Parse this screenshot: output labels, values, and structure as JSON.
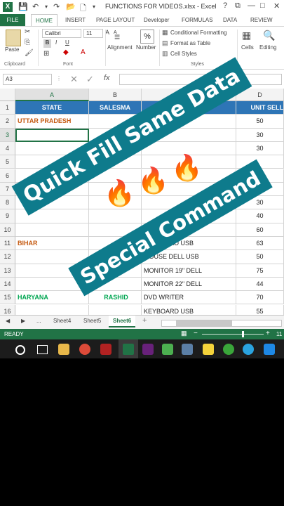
{
  "app": {
    "title": "FUNCTIONS FOR VIDEOS.xlsx - Excel",
    "window_controls": [
      "?",
      "⧉",
      "—",
      "□",
      "✕"
    ]
  },
  "tabs": [
    {
      "label": "FILE"
    },
    {
      "label": "HOME"
    },
    {
      "label": "INSERT"
    },
    {
      "label": "PAGE LAYOUT"
    },
    {
      "label": "Developer"
    },
    {
      "label": "FORMULAS"
    },
    {
      "label": "DATA"
    },
    {
      "label": "REVIEW"
    }
  ],
  "ribbon": {
    "paste_label": "Paste",
    "font_name": "Calibri",
    "font_size": "11",
    "bold": "B",
    "italic": "I",
    "underline": "U",
    "alignment_label": "Alignment",
    "number_label": "Number",
    "percent": "%",
    "conditional_formatting": "Conditional Formatting",
    "format_as_table": "Format as Table",
    "cell_styles": "Cell Styles",
    "cells_label": "Cells",
    "editing_label": "Editing",
    "group_clipboard": "Clipboard",
    "group_font": "Font",
    "group_styles": "Styles"
  },
  "formula_bar": {
    "name_box": "A3",
    "fx": "fx",
    "content": ""
  },
  "grid": {
    "columns": [
      "A",
      "B",
      "C",
      "D"
    ],
    "header_row": {
      "state": "STATE",
      "salesman": "SALESMA",
      "unit_sell": "UNIT SELL"
    },
    "rows": [
      {
        "num": "1"
      },
      {
        "num": "2",
        "a": "UTTAR PRADESH",
        "c": "",
        "d": "50"
      },
      {
        "num": "3",
        "a": "",
        "c": "",
        "d": "30"
      },
      {
        "num": "4",
        "a": "",
        "c": "",
        "d": "30"
      },
      {
        "num": "5",
        "a": "",
        "c": "",
        "d": ""
      },
      {
        "num": "6",
        "a": "",
        "c": "",
        "d": ""
      },
      {
        "num": "7",
        "a": "",
        "c": "",
        "d": ""
      },
      {
        "num": "8",
        "a": "",
        "c": "",
        "d": "30"
      },
      {
        "num": "9",
        "a": "",
        "c": "",
        "d": "40"
      },
      {
        "num": "10",
        "a": "",
        "c": "",
        "d": "60"
      },
      {
        "num": "11",
        "a": "BIHAR",
        "c": "KEYBOARD USB",
        "d": "63"
      },
      {
        "num": "12",
        "a": "",
        "c": "MOUSE DELL USB",
        "d": "50"
      },
      {
        "num": "13",
        "a": "",
        "c": "MONITOR 19\" DELL",
        "d": "75"
      },
      {
        "num": "14",
        "a": "",
        "c": "MONITOR 22\" DELL",
        "d": "44"
      },
      {
        "num": "15",
        "a": "HARYANA",
        "b": "RASHID",
        "c": "DVD WRITER",
        "d": "70"
      },
      {
        "num": "16",
        "a": "",
        "c": "KEYBOARD USB",
        "d": "55"
      }
    ]
  },
  "sheets": {
    "nav_prev": "◀",
    "nav_next": "▶",
    "ellipsis": "...",
    "tabs": [
      "Sheet4",
      "Sheet5",
      "Sheet6"
    ],
    "active": "Sheet6",
    "add": "+"
  },
  "status": {
    "ready": "READY",
    "zoom": "11"
  },
  "overlay": {
    "line1": "Quick Fill Same Data",
    "line2": "Special Command",
    "emoji": [
      "🔥",
      "🔥",
      "🔥"
    ]
  },
  "colors": {
    "excel_green": "#217346",
    "header_blue": "#2e75b6",
    "banner_teal": "#0e7b8c",
    "state_orange": "#c55a11",
    "state_green": "#00a651"
  }
}
